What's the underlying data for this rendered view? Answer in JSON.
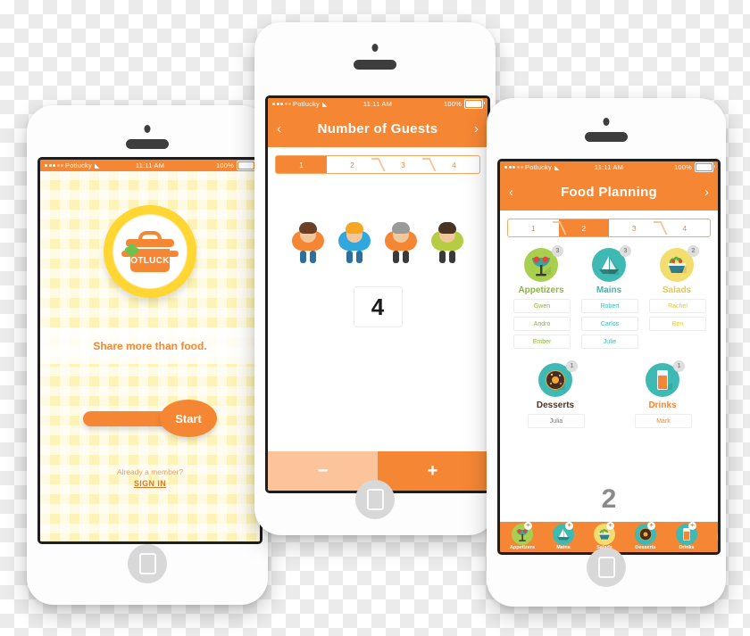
{
  "brand": {
    "accent_orange": "#f58634",
    "accent_yellow": "#ffd632",
    "teal": "#3fb9b4",
    "green": "#a9cf4f"
  },
  "status_bar": {
    "carrier": "Potlucky",
    "time": "11:11 AM",
    "battery_percent": "100%",
    "wifi_icon": "wifi-icon",
    "signal_icon": "signal-dots-icon",
    "battery_icon": "battery-icon"
  },
  "phone1": {
    "name": "splash-screen",
    "logo_text": "POTLUCKY",
    "logo_icon": "cooking-pot-icon",
    "clover_icon": "clover-icon",
    "tagline": "Share more than food.",
    "start_button": "Start",
    "member_prompt": "Already a member?",
    "sign_in": "SIGN IN",
    "home_button_icon": "home-button-icon"
  },
  "phone2": {
    "name": "number-of-guests-screen",
    "title": "Number of Guests",
    "back_icon": "chevron-left-icon",
    "forward_icon": "chevron-right-icon",
    "steps": [
      {
        "label": "1",
        "active": true
      },
      {
        "label": "2",
        "active": false
      },
      {
        "label": "3",
        "active": false
      },
      {
        "label": "4",
        "active": false
      }
    ],
    "guests": [
      {
        "name": "guest-avatar-1",
        "hair": "#6b4026",
        "shirt": "#f58634",
        "legs": "#2f6f9e"
      },
      {
        "name": "guest-avatar-2",
        "hair": "#f5a623",
        "shirt": "#31a8dd",
        "legs": "#2e6f9c"
      },
      {
        "name": "guest-avatar-3",
        "hair": "#9a9a9a",
        "shirt": "#f58634",
        "legs": "#3a3a3a"
      },
      {
        "name": "guest-avatar-4",
        "hair": "#4a3424",
        "shirt": "#b5cc43",
        "legs": "#3a3a3a"
      }
    ],
    "count_value": "4",
    "decrement_label": "−",
    "increment_label": "+",
    "home_button_icon": "home-button-icon"
  },
  "phone3": {
    "name": "food-planning-screen",
    "title": "Food Planning",
    "back_icon": "chevron-left-icon",
    "forward_icon": "chevron-right-icon",
    "steps": [
      {
        "label": "1",
        "active": false
      },
      {
        "label": "2",
        "active": true
      },
      {
        "label": "3",
        "active": false
      },
      {
        "label": "4",
        "active": false
      }
    ],
    "categories": [
      {
        "label": "Appetizers",
        "count": "3",
        "icon": "appetizer-icon",
        "circle": "#a9cf4f",
        "text_color": "#8cb63c",
        "people": [
          "Gwen",
          "Andro",
          "Ember"
        ]
      },
      {
        "label": "Mains",
        "count": "3",
        "icon": "mains-boat-icon",
        "circle": "#3fb9b4",
        "text_color": "#3fb9b4",
        "people": [
          "Robert",
          "Carlos",
          "Julie"
        ]
      },
      {
        "label": "Salads",
        "count": "2",
        "icon": "salad-bowl-icon",
        "circle": "#f2dd6e",
        "text_color": "#e8c93c",
        "people": [
          "Rachel",
          "Ben"
        ]
      },
      {
        "label": "Desserts",
        "count": "1",
        "icon": "donut-icon",
        "circle": "#3fb9b4",
        "text_color": "#4a3428",
        "people": [
          "Julia"
        ]
      },
      {
        "label": "Drinks",
        "count": "1",
        "icon": "drink-glass-icon",
        "circle": "#3fb9b4",
        "text_color": "#f58634",
        "people": [
          "Mark"
        ]
      }
    ],
    "remaining_count": "2",
    "tabs": [
      {
        "label": "Appetizers",
        "icon": "appetizer-icon",
        "circle": "#a9cf4f",
        "add": "+"
      },
      {
        "label": "Mains",
        "icon": "mains-boat-icon",
        "circle": "#3fb9b4",
        "add": "+"
      },
      {
        "label": "Salads",
        "icon": "salad-bowl-icon",
        "circle": "#f2dd6e",
        "add": "+"
      },
      {
        "label": "Desserts",
        "icon": "donut-icon",
        "circle": "#3fb9b4",
        "add": "+"
      },
      {
        "label": "Drinks",
        "icon": "drink-glass-icon",
        "circle": "#3fb9b4",
        "add": "+"
      },
      {
        "label": "",
        "icon": "appetizer-icon",
        "circle": "#a9cf4f",
        "add": "+"
      }
    ],
    "home_button_icon": "home-button-icon"
  }
}
